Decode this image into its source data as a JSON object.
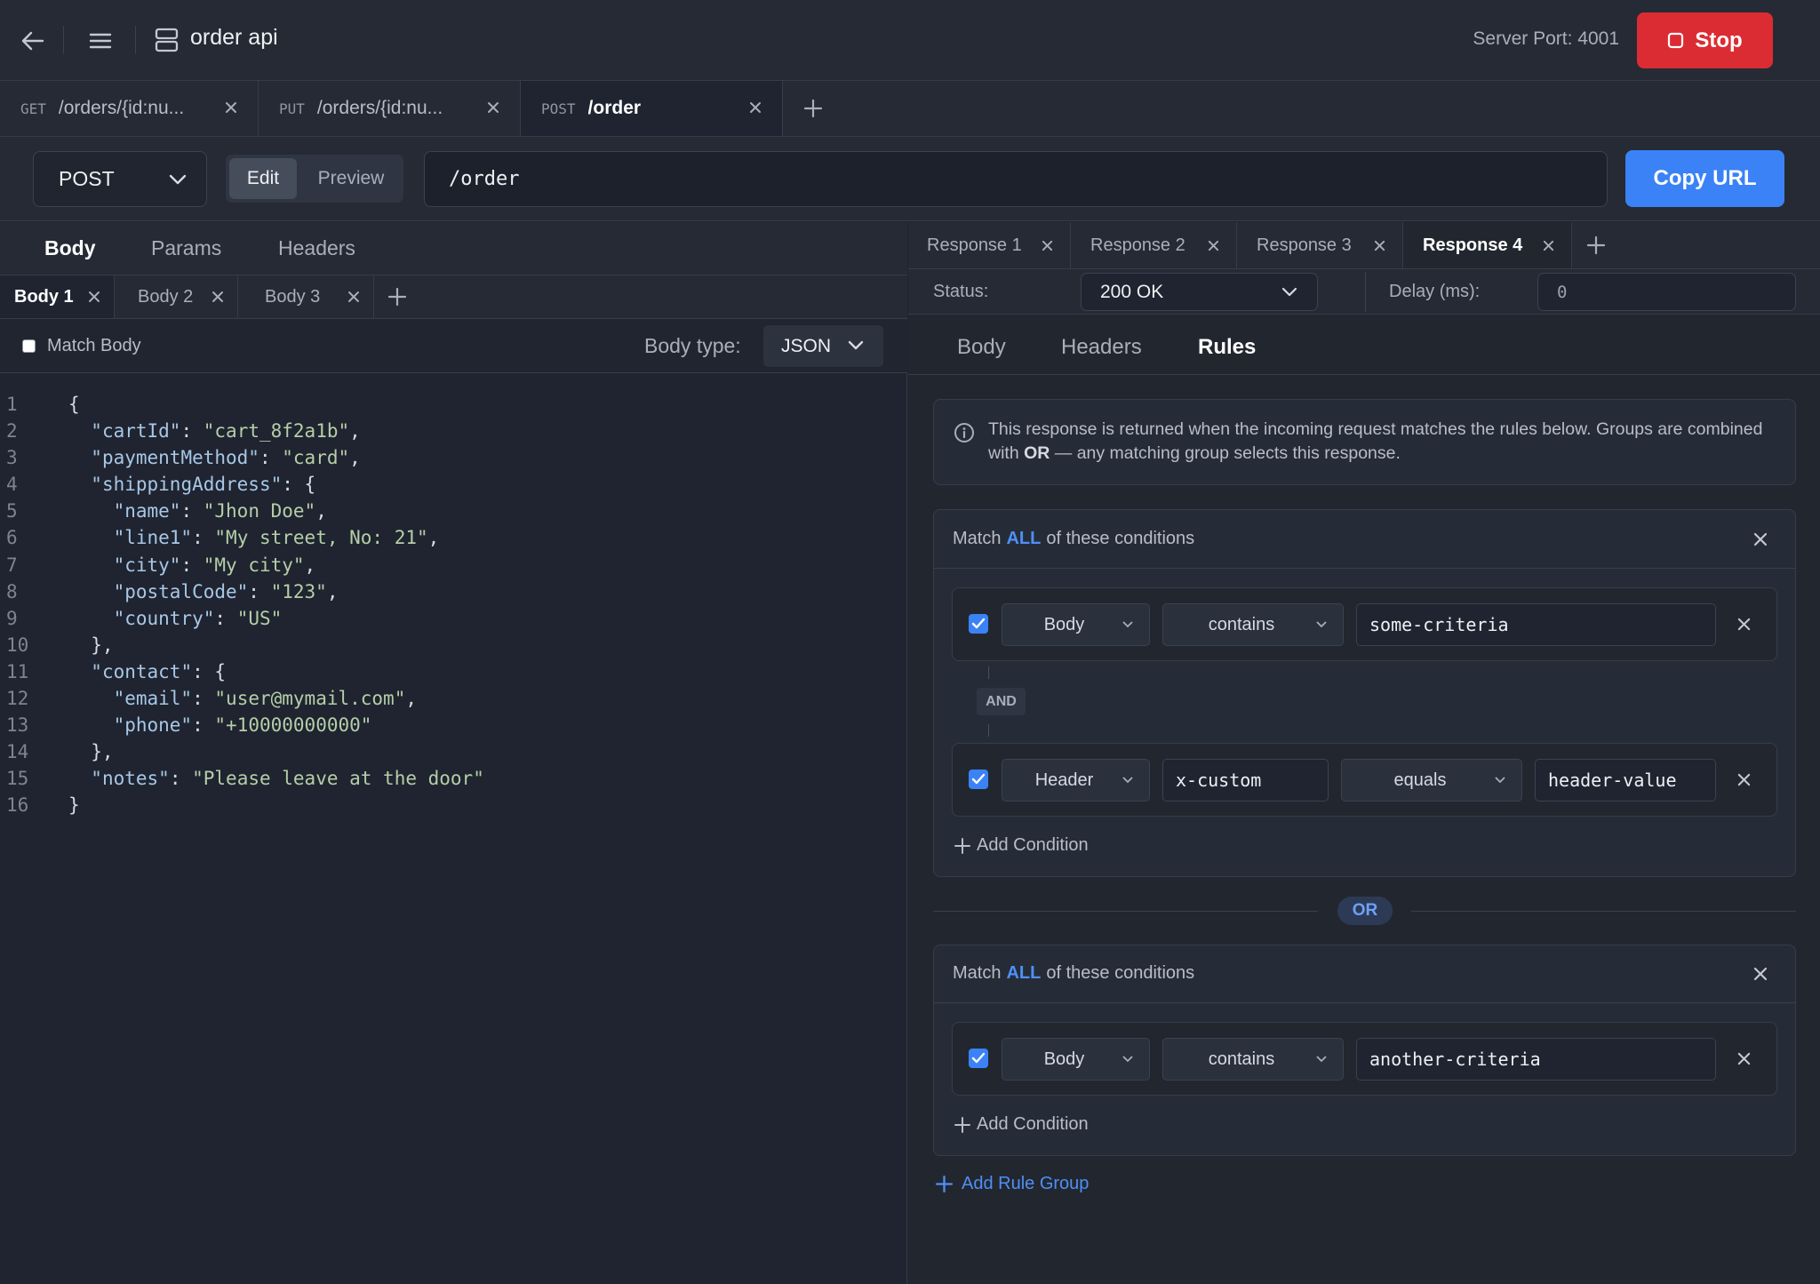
{
  "header": {
    "title": "order api",
    "server_port": "Server Port: 4001",
    "stop_label": "Stop"
  },
  "request_tabs": [
    {
      "method": "GET",
      "path": "/orders/{id:nu..."
    },
    {
      "method": "PUT",
      "path": "/orders/{id:nu..."
    },
    {
      "method": "POST",
      "path": "/order"
    }
  ],
  "request": {
    "method": "POST",
    "mode_edit": "Edit",
    "mode_preview": "Preview",
    "url": "/order",
    "copy_url_label": "Copy URL"
  },
  "left_tabs": [
    "Body",
    "Params",
    "Headers"
  ],
  "body_tabs": [
    "Body 1",
    "Body 2",
    "Body 3"
  ],
  "match_body_label": "Match Body",
  "body_type_label": "Body type:",
  "body_type_value": "JSON",
  "code_lines": [
    "{",
    "  \"cartId\": \"cart_8f2a1b\",",
    "  \"paymentMethod\": \"card\",",
    "  \"shippingAddress\": {",
    "    \"name\": \"Jhon Doe\",",
    "    \"line1\": \"My street, No: 21\",",
    "    \"city\": \"My city\",",
    "    \"postalCode\": \"123\",",
    "    \"country\": \"US\"",
    "  },",
    "  \"contact\": {",
    "    \"email\": \"user@mymail.com\",",
    "    \"phone\": \"+10000000000\"",
    "  },",
    "  \"notes\": \"Please leave at the door\"",
    "}"
  ],
  "response_tabs": [
    "Response 1",
    "Response 2",
    "Response 3",
    "Response 4"
  ],
  "status_label": "Status:",
  "status_value": "200 OK",
  "delay_label": "Delay (ms):",
  "delay_value": "0",
  "sub_tabs": [
    "Body",
    "Headers",
    "Rules"
  ],
  "info": {
    "text_a": "This response is returned when the incoming request matches the rules below. Groups are combined with ",
    "text_bold": "OR",
    "text_b": " — any matching group selects this response."
  },
  "rule_groups": [
    {
      "match_prefix": "Match",
      "match_mode": "ALL",
      "match_suffix": "of these conditions",
      "conditions": [
        {
          "source": "Body",
          "operator": "contains",
          "value": "some-criteria"
        },
        {
          "source": "Header",
          "key": "x-custom",
          "operator": "equals",
          "value": "header-value"
        }
      ],
      "joiner": "AND",
      "add_condition_label": "Add Condition"
    },
    {
      "match_prefix": "Match",
      "match_mode": "ALL",
      "match_suffix": "of these conditions",
      "conditions": [
        {
          "source": "Body",
          "operator": "contains",
          "value": "another-criteria"
        }
      ],
      "add_condition_label": "Add Condition"
    }
  ],
  "or_label": "OR",
  "add_rule_group_label": "Add Rule Group"
}
